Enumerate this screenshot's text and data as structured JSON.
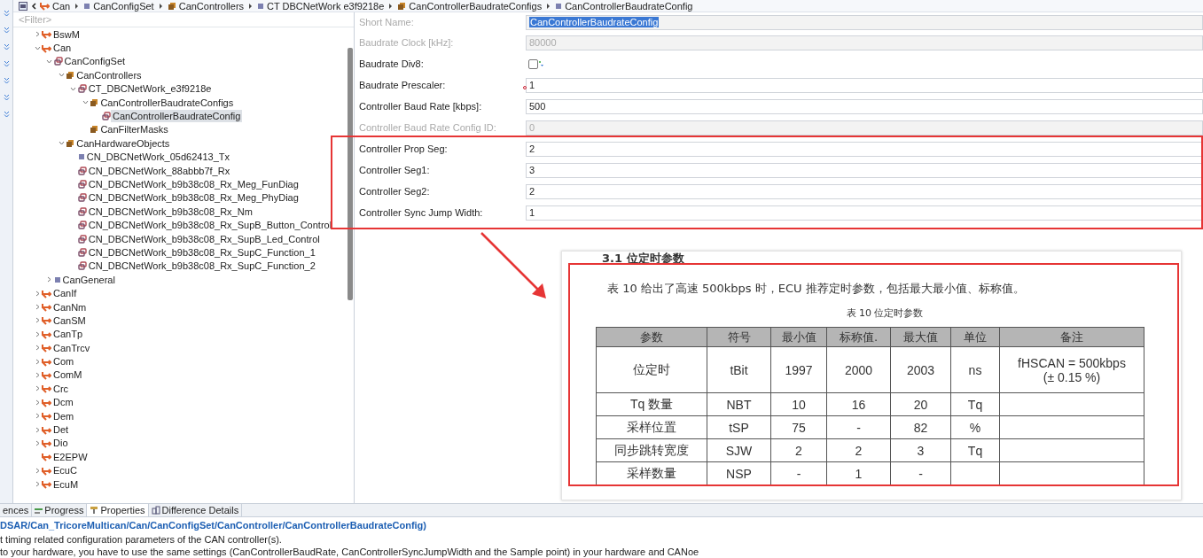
{
  "breadcrumb": [
    {
      "label": "Can",
      "kind": "module"
    },
    {
      "label": "CanConfigSet",
      "kind": "param"
    },
    {
      "label": "CanControllers",
      "kind": "container"
    },
    {
      "label": "CT DBCNetWork e3f9218e",
      "kind": "param"
    },
    {
      "label": "CanControllerBaudrateConfigs",
      "kind": "container"
    },
    {
      "label": "CanControllerBaudrateConfig",
      "kind": "param"
    }
  ],
  "tree": {
    "placeholder": "<Filter>",
    "items": [
      {
        "label": "BswM",
        "kind": "module",
        "expanded": false,
        "selected": false
      },
      {
        "label": "Can",
        "kind": "module",
        "expanded": true,
        "selected": false,
        "children": [
          {
            "label": "CanConfigSet",
            "kind": "instance",
            "expanded": true,
            "selected": false,
            "children": [
              {
                "label": "CanControllers",
                "kind": "container",
                "expanded": true,
                "selected": false,
                "children": [
                  {
                    "label": "CT_DBCNetWork_e3f9218e",
                    "kind": "instance",
                    "expanded": true,
                    "selected": false,
                    "children": [
                      {
                        "label": "CanControllerBaudrateConfigs",
                        "kind": "container",
                        "expanded": true,
                        "selected": false,
                        "children": [
                          {
                            "label": "CanControllerBaudrateConfig",
                            "kind": "instance",
                            "selected": true
                          }
                        ]
                      },
                      {
                        "label": "CanFilterMasks",
                        "kind": "container",
                        "selected": false
                      }
                    ]
                  }
                ]
              },
              {
                "label": "CanHardwareObjects",
                "kind": "container",
                "expanded": true,
                "selected": false,
                "children": [
                  {
                    "label": "CN_DBCNetWork_05d62413_Tx",
                    "kind": "param",
                    "selected": false
                  },
                  {
                    "label": "CN_DBCNetWork_88abbb7f_Rx",
                    "kind": "instance",
                    "selected": false
                  },
                  {
                    "label": "CN_DBCNetWork_b9b38c08_Rx_Meg_FunDiag",
                    "kind": "instance",
                    "selected": false
                  },
                  {
                    "label": "CN_DBCNetWork_b9b38c08_Rx_Meg_PhyDiag",
                    "kind": "instance",
                    "selected": false
                  },
                  {
                    "label": "CN_DBCNetWork_b9b38c08_Rx_Nm",
                    "kind": "instance",
                    "selected": false
                  },
                  {
                    "label": "CN_DBCNetWork_b9b38c08_Rx_SupB_Button_Control",
                    "kind": "instance",
                    "selected": false
                  },
                  {
                    "label": "CN_DBCNetWork_b9b38c08_Rx_SupB_Led_Control",
                    "kind": "instance",
                    "selected": false
                  },
                  {
                    "label": "CN_DBCNetWork_b9b38c08_Rx_SupC_Function_1",
                    "kind": "instance",
                    "selected": false
                  },
                  {
                    "label": "CN_DBCNetWork_b9b38c08_Rx_SupC_Function_2",
                    "kind": "instance",
                    "selected": false
                  }
                ]
              }
            ]
          },
          {
            "label": "CanGeneral",
            "kind": "param",
            "expanded": false,
            "selected": false
          }
        ]
      },
      {
        "label": "CanIf",
        "kind": "module",
        "expanded": false,
        "selected": false
      },
      {
        "label": "CanNm",
        "kind": "module",
        "expanded": false,
        "selected": false
      },
      {
        "label": "CanSM",
        "kind": "module",
        "expanded": false,
        "selected": false
      },
      {
        "label": "CanTp",
        "kind": "module",
        "expanded": false,
        "selected": false
      },
      {
        "label": "CanTrcv",
        "kind": "module",
        "expanded": false,
        "selected": false
      },
      {
        "label": "Com",
        "kind": "module",
        "expanded": false,
        "selected": false
      },
      {
        "label": "ComM",
        "kind": "module",
        "expanded": false,
        "selected": false
      },
      {
        "label": "Crc",
        "kind": "module",
        "expanded": false,
        "selected": false
      },
      {
        "label": "Dcm",
        "kind": "module",
        "expanded": false,
        "selected": false
      },
      {
        "label": "Dem",
        "kind": "module",
        "expanded": false,
        "selected": false
      },
      {
        "label": "Det",
        "kind": "module",
        "expanded": false,
        "selected": false
      },
      {
        "label": "Dio",
        "kind": "module",
        "expanded": false,
        "selected": false
      },
      {
        "label": "E2EPW",
        "kind": "module",
        "selected": false
      },
      {
        "label": "EcuC",
        "kind": "module",
        "expanded": false,
        "selected": false
      },
      {
        "label": "EcuM",
        "kind": "module",
        "expanded": false,
        "selected": false
      }
    ]
  },
  "form": [
    {
      "label": "Short Name:",
      "value": "CanControllerBaudrateConfig",
      "kind": "text",
      "disabled": true,
      "value_selected": true
    },
    {
      "label": "Baudrate Clock [kHz]:",
      "value": "80000",
      "kind": "text",
      "disabled": true
    },
    {
      "label": "Baudrate Div8:",
      "kind": "checkbox",
      "checked": false,
      "disabled": false
    },
    {
      "label": "Baudrate Prescaler:",
      "value": "1",
      "kind": "text",
      "disabled": false,
      "warning": true
    },
    {
      "label": "Controller Baud Rate [kbps]:",
      "value": "500",
      "kind": "text",
      "disabled": false
    },
    {
      "label": "Controller Baud Rate Config ID:",
      "value": "0",
      "kind": "text",
      "disabled": true
    },
    {
      "label": "Controller Prop Seg:",
      "value": "2",
      "kind": "text",
      "disabled": false
    },
    {
      "label": "Controller Seg1:",
      "value": "3",
      "kind": "text",
      "disabled": false
    },
    {
      "label": "Controller Seg2:",
      "value": "2",
      "kind": "text",
      "disabled": false
    },
    {
      "label": "Controller Sync Jump Width:",
      "value": "1",
      "kind": "text",
      "disabled": false
    }
  ],
  "document": {
    "heading": "3.1  位定时参数",
    "intro": "表 10 给出了高速 500kbps 时，ECU 推荐定时参数，包括最大最小值、标称值。",
    "caption": "表 10  位定时参数",
    "columns": [
      "参数",
      "符号",
      "最小值",
      "标称值.",
      "最大值",
      "单位",
      "备注"
    ],
    "rows": [
      [
        "位定时",
        "tBit",
        "1997",
        "2000",
        "2003",
        "ns",
        "fHSCAN = 500kbps\n(± 0.15 %)"
      ],
      [
        "Tq 数量",
        "NBT",
        "10",
        "16",
        "20",
        "Tq",
        ""
      ],
      [
        "采样位置",
        "tSP",
        "75",
        "-",
        "82",
        "%",
        ""
      ],
      [
        "同步跳转宽度",
        "SJW",
        "2",
        "2",
        "3",
        "Tq",
        ""
      ],
      [
        "采样数量",
        "NSP",
        "-",
        "1",
        "-",
        "",
        ""
      ]
    ]
  },
  "bottom": {
    "tabs": [
      {
        "label": "ences",
        "kind": "references",
        "selected": false
      },
      {
        "label": "Progress",
        "kind": "progress",
        "selected": false
      },
      {
        "label": "Properties",
        "kind": "properties",
        "selected": true
      },
      {
        "label": "Difference Details",
        "kind": "difference",
        "selected": false
      }
    ],
    "path": "DSAR/Can_TricoreMultican/Can/CanConfigSet/CanController/CanControllerBaudrateConfig)",
    "description": [
      "t timing related configuration parameters of the CAN controller(s).",
      "to your hardware, you have to use the same settings (CanControllerBaudRate, CanControllerSyncJumpWidth and the Sample point) in your hardware and CANoe"
    ]
  }
}
